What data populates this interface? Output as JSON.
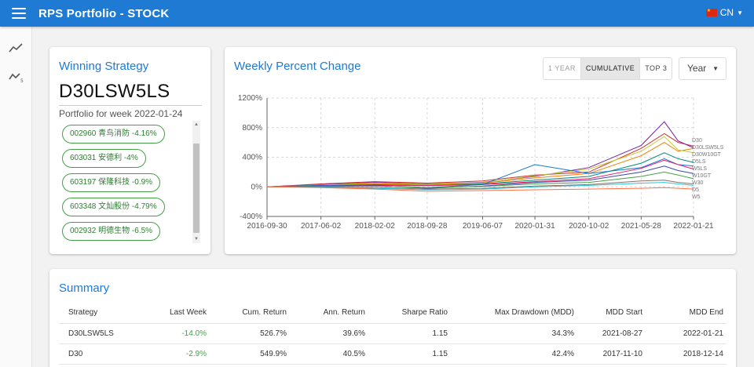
{
  "app": {
    "title": "RPS Portfolio - STOCK",
    "language": "CN"
  },
  "winning": {
    "title": "Winning Strategy",
    "strategy": "D30LSW5LS",
    "week_label": "Portfolio for week 2022-01-24",
    "holdings": [
      "002960 青鸟消防 -4.16%",
      "603031 安德利 -4%",
      "603197 保隆科技 -0.9%",
      "603348 文灿股份 -4.79%",
      "002932 明德生物 -6.5%"
    ]
  },
  "weekly": {
    "title": "Weekly Percent Change",
    "toggles": [
      "1 YEAR",
      "CUMULATIVE",
      "TOP 3"
    ],
    "period": "Year"
  },
  "summary": {
    "title": "Summary",
    "columns": [
      "Strategy",
      "Last Week",
      "Cum. Return",
      "Ann. Return",
      "Sharpe Ratio",
      "Max Drawdown (MDD)",
      "MDD Start",
      "MDD End"
    ],
    "rows": [
      [
        "D30LSW5LS",
        "-14.0%",
        "526.7%",
        "39.6%",
        "1.15",
        "34.3%",
        "2021-08-27",
        "2022-01-21"
      ],
      [
        "D30",
        "-2.9%",
        "549.9%",
        "40.5%",
        "1.15",
        "42.4%",
        "2017-11-10",
        "2018-12-14"
      ]
    ]
  },
  "colors": {
    "primary": "#1f7ad4",
    "positive": "#43a047"
  },
  "chart_data": {
    "type": "line",
    "title": "Weekly Percent Change",
    "ylim": [
      -400,
      1200
    ],
    "yticks": [
      "1200%",
      "800%",
      "400%",
      "0%",
      "-400%"
    ],
    "xticks": [
      "2016-09-30",
      "2017-06-02",
      "2018-02-02",
      "2018-09-28",
      "2019-06-07",
      "2020-01-31",
      "2020-10-02",
      "2021-05-28",
      "2022-01-21"
    ],
    "x": [
      "2016-09-30",
      "2017-06-02",
      "2018-02-02",
      "2018-09-28",
      "2019-06-07",
      "2020-01-31",
      "2020-10-02",
      "2021-05-28",
      "2021-09-10",
      "2021-11-12",
      "2022-01-21"
    ],
    "end_labels": [
      "D30",
      "D30LSW5LS",
      "D30W10GT",
      "D5LS",
      "W5LS",
      "W10GT",
      "W30",
      "D5",
      "W5"
    ],
    "series": [
      {
        "color": "#d32f2f",
        "values": [
          0,
          40,
          70,
          50,
          80,
          160,
          200,
          520,
          720,
          600,
          550
        ]
      },
      {
        "color": "#7b1fa2",
        "values": [
          0,
          30,
          60,
          40,
          60,
          140,
          260,
          560,
          880,
          620,
          527
        ]
      },
      {
        "color": "#f57c00",
        "values": [
          0,
          20,
          40,
          30,
          50,
          120,
          180,
          420,
          600,
          480,
          520
        ]
      },
      {
        "color": "#c0ca33",
        "values": [
          0,
          25,
          50,
          35,
          55,
          150,
          240,
          480,
          680,
          500,
          460
        ]
      },
      {
        "color": "#00897b",
        "values": [
          0,
          15,
          30,
          20,
          40,
          90,
          140,
          320,
          460,
          380,
          330
        ]
      },
      {
        "color": "#1976d2",
        "values": [
          0,
          20,
          10,
          -10,
          30,
          300,
          180,
          260,
          380,
          300,
          280
        ]
      },
      {
        "color": "#e91e63",
        "values": [
          0,
          10,
          20,
          15,
          30,
          70,
          110,
          250,
          360,
          300,
          240
        ]
      },
      {
        "color": "#3949ab",
        "values": [
          0,
          10,
          15,
          -20,
          10,
          60,
          90,
          200,
          280,
          220,
          180
        ]
      },
      {
        "color": "#43a047",
        "values": [
          0,
          5,
          10,
          -10,
          5,
          40,
          60,
          140,
          200,
          160,
          110
        ]
      },
      {
        "color": "#8d6e63",
        "values": [
          0,
          0,
          -10,
          -30,
          -20,
          10,
          30,
          80,
          90,
          60,
          40
        ]
      },
      {
        "color": "#26c6da",
        "values": [
          0,
          -5,
          -20,
          -40,
          -30,
          0,
          20,
          50,
          60,
          40,
          20
        ]
      },
      {
        "color": "#ff7043",
        "values": [
          0,
          -10,
          -30,
          -60,
          -50,
          -40,
          -30,
          -20,
          -10,
          -20,
          -30
        ]
      }
    ]
  }
}
